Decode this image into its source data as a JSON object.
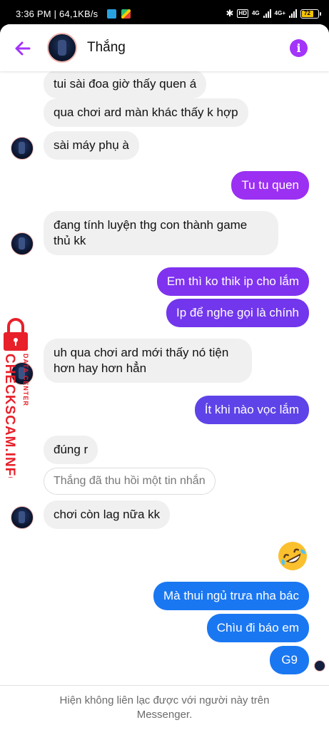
{
  "status_bar": {
    "time": "3:36 PM",
    "speed": "64,1KB/s",
    "hd_label": "HD",
    "net_label_1": "4G",
    "net_label_2": "4G+",
    "battery_label": "72",
    "battery_percent": 72
  },
  "header": {
    "contact_name": "Thắng",
    "back_icon": "back-arrow-icon",
    "info_icon": "info-icon",
    "info_glyph": "i",
    "accent_color": "#a334fa"
  },
  "messages": [
    {
      "direction": "in",
      "text": "tui sài đoa giờ thấy quen á"
    },
    {
      "direction": "in",
      "text": "qua chơi ard màn khác thấy k hợp"
    },
    {
      "direction": "in",
      "text": "sài máy phụ à"
    },
    {
      "direction": "out",
      "text": "Tu tu quen"
    },
    {
      "direction": "in",
      "line1": "đang tính luyện thg con thành game",
      "line2": "thủ kk"
    },
    {
      "direction": "out",
      "text": "Em thì ko thik ip cho lắm"
    },
    {
      "direction": "out",
      "text": "Ip để nghe gọi là chính"
    },
    {
      "direction": "in",
      "line1": "uh qua chơi ard mới thấy nó tiện",
      "line2": "hơn hay hơn hẳn"
    },
    {
      "direction": "out",
      "text": "Ít khi nào vọc lắm"
    },
    {
      "direction": "in",
      "text": "đúng r"
    },
    {
      "direction": "in",
      "recalled": true,
      "text": "Thắng đã thu hồi một tin nhắn"
    },
    {
      "direction": "in",
      "text": "chơi còn lag nữa kk"
    },
    {
      "direction": "out",
      "emoji": "rolling-on-floor-laughing-icon"
    },
    {
      "direction": "out",
      "text": "Mà thui ngủ trưa nha bác"
    },
    {
      "direction": "out",
      "text": "Chìu đi báo em"
    },
    {
      "direction": "out",
      "text": "G9"
    }
  ],
  "watermark": {
    "main": "CHECKSCAM.INFO",
    "sub": "DATA CENTER",
    "color": "#e8202a"
  },
  "footer": {
    "line1": "Hiện không liên lạc được với người này trên",
    "line2": "Messenger."
  },
  "colors": {
    "bubble_in": "#f0f0f0",
    "bubble_out_purple": "#9b2ff2",
    "bubble_out_violet": "#6c3ce9",
    "bubble_out_blue": "#1a77f2"
  }
}
